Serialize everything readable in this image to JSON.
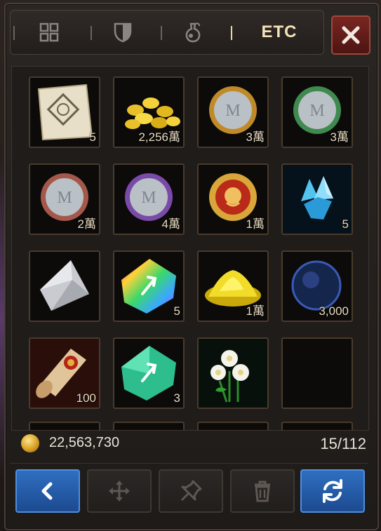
{
  "tabs": [
    {
      "id": "all",
      "icon": "grid-icon",
      "label": ""
    },
    {
      "id": "equipment",
      "icon": "shield-icon",
      "label": ""
    },
    {
      "id": "consumable",
      "icon": "potion-icon",
      "label": ""
    },
    {
      "id": "etc",
      "icon": "",
      "label": "ETC",
      "active": true
    }
  ],
  "close_icon": "close-icon",
  "items": [
    {
      "name": "ancient-scroll-map",
      "qty": "5"
    },
    {
      "name": "gold-coins-pile",
      "qty": "2,256萬"
    },
    {
      "name": "gold-medal-coin",
      "qty": "3萬"
    },
    {
      "name": "green-medal-coin",
      "qty": "3萬"
    },
    {
      "name": "bronze-medal-coin",
      "qty": "2萬"
    },
    {
      "name": "purple-medal-coin",
      "qty": "4萬"
    },
    {
      "name": "lion-emblem-coin",
      "qty": "1萬"
    },
    {
      "name": "blue-crystal",
      "qty": "5"
    },
    {
      "name": "white-cloth",
      "qty": ""
    },
    {
      "name": "rainbow-gem",
      "qty": "5"
    },
    {
      "name": "gold-dust-pile",
      "qty": "1萬"
    },
    {
      "name": "dark-blue-orb",
      "qty": "3,000"
    },
    {
      "name": "red-seal-scroll",
      "qty": "100"
    },
    {
      "name": "green-gem",
      "qty": "3"
    },
    {
      "name": "white-flower",
      "qty": ""
    },
    {
      "name": "empty",
      "qty": ""
    }
  ],
  "footer": {
    "gold": "22,563,730",
    "capacity": "15/112"
  },
  "bottom_buttons": [
    {
      "icon": "chevron-left-icon"
    },
    {
      "icon": "move-arrows-icon"
    },
    {
      "icon": "pin-icon"
    },
    {
      "icon": "trash-icon"
    },
    {
      "icon": "refresh-icon"
    }
  ]
}
